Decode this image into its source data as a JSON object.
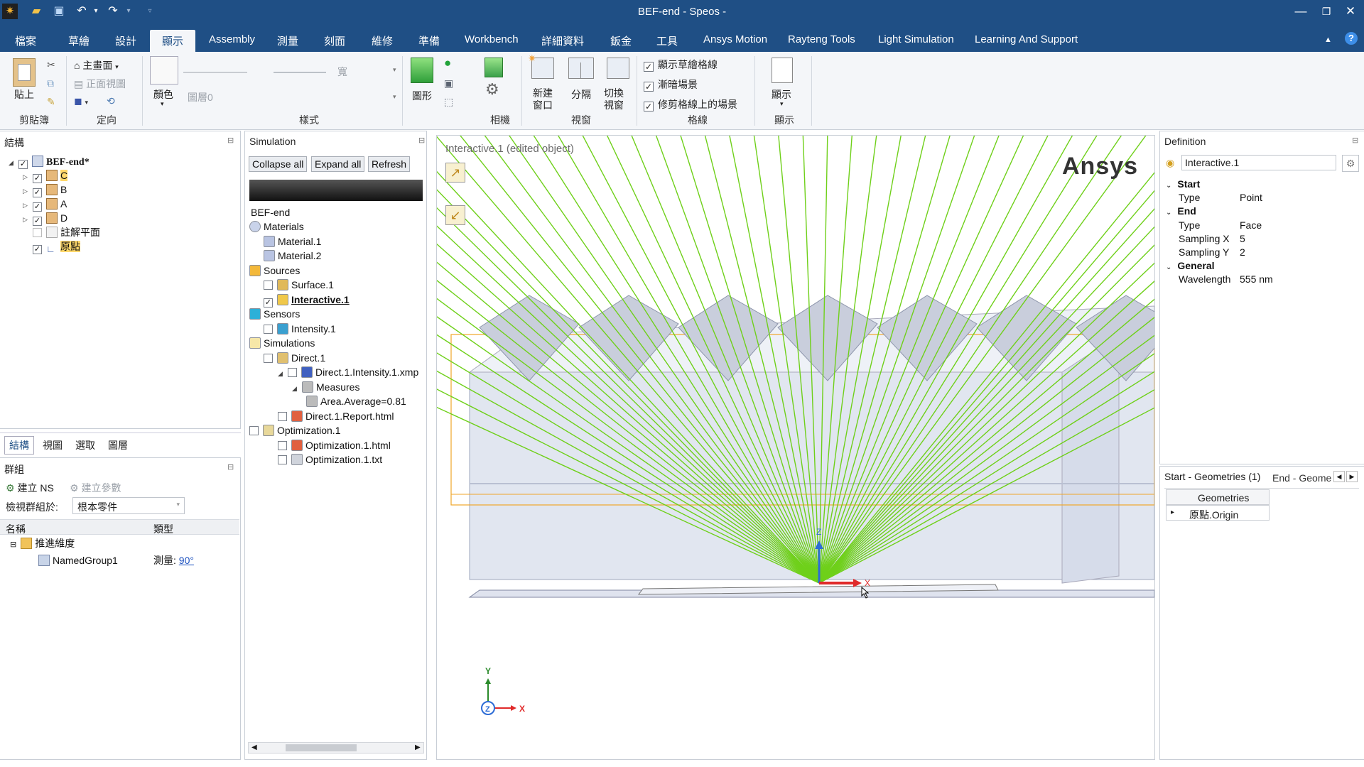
{
  "window": {
    "title": "BEF-end - Speos -"
  },
  "quick_access": {
    "icons": [
      "app-logo-icon",
      "open-icon",
      "save-icon",
      "undo-icon",
      "redo-icon",
      "customize-icon"
    ]
  },
  "window_controls": {
    "minimize": "—",
    "restore": "❐",
    "close": "✕"
  },
  "menu": {
    "tabs": [
      "檔案",
      "草繪",
      "設計",
      "顯示",
      "Assembly",
      "測量",
      "刻面",
      "維修",
      "準備",
      "Workbench",
      "詳細資料",
      "鈑金",
      "工具",
      "Ansys Motion",
      "Rayteng Tools",
      "Light Simulation",
      "Learning And Support"
    ],
    "active": "顯示"
  },
  "ribbon": {
    "clipboard": {
      "label": "剪貼簿",
      "paste": "貼上"
    },
    "orient": {
      "label": "定向",
      "home": "主畫面",
      "front": "正面視圖"
    },
    "style": {
      "label": "樣式",
      "color": "顏色",
      "layer": "圖層0",
      "width": "寬"
    },
    "camera": {
      "label": "相機",
      "graphics": "圖形"
    },
    "window": {
      "label": "視窗",
      "new_window": "新建\n窗口",
      "split": "分隔",
      "switch": "切換\n視窗"
    },
    "grid": {
      "label": "格線",
      "options": [
        "顯示草繪格線",
        "漸暗場景",
        "修剪格線上的場景"
      ]
    },
    "show": {
      "label": "顯示",
      "btn": "顯示"
    }
  },
  "structure": {
    "title": "結構",
    "root": "BEF-end*",
    "items": [
      {
        "label": "C",
        "checked": true
      },
      {
        "label": "B",
        "checked": true
      },
      {
        "label": "A",
        "checked": true
      },
      {
        "label": "D",
        "checked": true
      },
      {
        "label": "註解平面",
        "checked": false
      },
      {
        "label": "原點",
        "checked": true
      }
    ],
    "tabs": [
      "結構",
      "視圖",
      "選取",
      "圖層"
    ]
  },
  "groups": {
    "title": "群組",
    "create_ns": "建立 NS",
    "create_param": "建立參數",
    "view_by_label": "檢視群組於:",
    "view_by_value": "根本零件",
    "col_name": "名稱",
    "col_type": "類型",
    "folder": "推進維度",
    "row_name": "NamedGroup1",
    "row_type": "測量:",
    "row_value": "90°"
  },
  "simulation": {
    "title": "Simulation",
    "buttons": [
      "Collapse all",
      "Expand all",
      "Refresh"
    ],
    "root": "BEF-end",
    "tree": [
      {
        "label": "Materials",
        "indent": 0,
        "icon": "materials-icon",
        "cb": false
      },
      {
        "label": "Material.1",
        "indent": 1,
        "icon": "material-icon",
        "cb": false
      },
      {
        "label": "Material.2",
        "indent": 1,
        "icon": "material-icon",
        "cb": false
      },
      {
        "label": "Sources",
        "indent": 0,
        "icon": "sources-icon",
        "cb": false
      },
      {
        "label": "Surface.1",
        "indent": 1,
        "icon": "surface-source-icon",
        "cb": true,
        "checked": false
      },
      {
        "label": "Interactive.1",
        "indent": 1,
        "icon": "interactive-source-icon",
        "cb": true,
        "checked": true,
        "bold": true
      },
      {
        "label": "Sensors",
        "indent": 0,
        "icon": "sensors-icon",
        "cb": false
      },
      {
        "label": "Intensity.1",
        "indent": 1,
        "icon": "intensity-sensor-icon",
        "cb": true,
        "checked": false
      },
      {
        "label": "Simulations",
        "indent": 0,
        "icon": "simulations-icon",
        "cb": false
      },
      {
        "label": "Direct.1",
        "indent": 1,
        "icon": "direct-sim-icon",
        "cb": true,
        "checked": false
      },
      {
        "label": "Direct.1.Intensity.1.xmp",
        "indent": 2,
        "icon": "xmp-result-icon",
        "cb": true,
        "checked": false,
        "exp": true
      },
      {
        "label": "Measures",
        "indent": 3,
        "icon": "measure-icon",
        "cb": false,
        "exp": true
      },
      {
        "label": "Area.Average=0.81",
        "indent": 4,
        "icon": "measure-icon",
        "cb": false
      },
      {
        "label": "Direct.1.Report.html",
        "indent": 2,
        "icon": "html-report-icon",
        "cb": true,
        "checked": false
      },
      {
        "label": "Optimization.1",
        "indent": 0,
        "icon": "optimization-icon",
        "cb": true,
        "checked": false
      },
      {
        "label": "Optimization.1.html",
        "indent": 2,
        "icon": "html-report-icon",
        "cb": true,
        "checked": false
      },
      {
        "label": "Optimization.1.txt",
        "indent": 2,
        "icon": "txt-report-icon",
        "cb": true,
        "checked": false
      }
    ]
  },
  "viewport": {
    "caption": "Interactive.1 (edited object)",
    "brand": "Ansys",
    "axis_z": "Z",
    "axis_x": "X",
    "triad_y": "Y",
    "triad_z": "Z",
    "triad_x": "X"
  },
  "definition": {
    "title": "Definition",
    "name": "Interactive.1",
    "rows": [
      {
        "type": "section",
        "label": "Start"
      },
      {
        "type": "prop",
        "key": "Type",
        "value": "Point"
      },
      {
        "type": "section",
        "label": "End"
      },
      {
        "type": "prop",
        "key": "Type",
        "value": "Face"
      },
      {
        "type": "prop",
        "key": "Sampling X",
        "value": "5"
      },
      {
        "type": "prop",
        "key": "Sampling Y",
        "value": "2"
      },
      {
        "type": "section",
        "label": "General"
      },
      {
        "type": "prop",
        "key": "Wavelength",
        "value": "555 nm"
      }
    ],
    "geo_tabs": [
      "Start - Geometries (1)",
      "End - Geome"
    ],
    "geo_col": "Geometries",
    "geo_row": "原點.Origin"
  },
  "colors": {
    "title_bar": "#1f4f85",
    "ray": "#6fd01a",
    "accent": "#1f4f85"
  }
}
